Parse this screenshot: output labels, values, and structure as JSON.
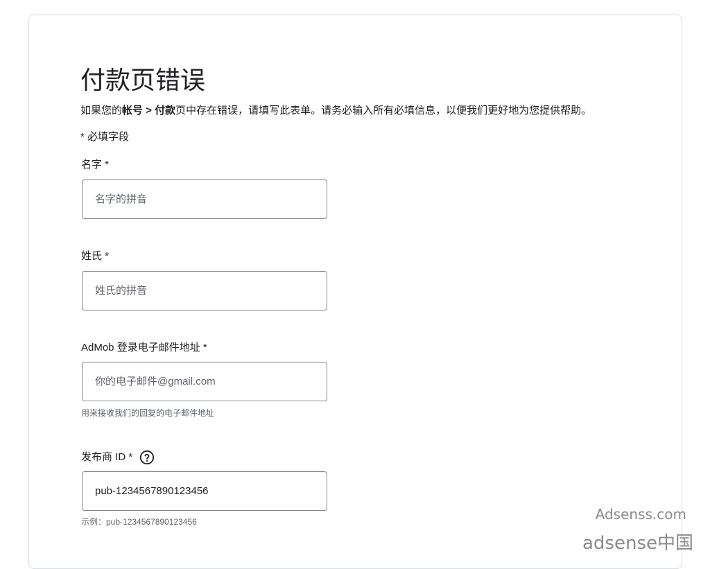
{
  "form": {
    "title": "付款页错误",
    "intro": {
      "prefix": "如果您的",
      "bold_account": "帐号 > 付款",
      "suffix": "页中存在错误，请填写此表单。请务必输入所有必填信息，以便我们更好地为您提供帮助。"
    },
    "required_note": "* 必填字段",
    "fields": {
      "first_name": {
        "label": "名字 *",
        "placeholder": "名字的拼音"
      },
      "last_name": {
        "label": "姓氏 *",
        "placeholder": "姓氏的拼音"
      },
      "email": {
        "label": "AdMob 登录电子邮件地址 *",
        "placeholder": "你的电子邮件@gmail.com",
        "hint": "用来接收我们的回复的电子邮件地址"
      },
      "publisher_id": {
        "label": "发布商 ID *",
        "value": "pub-1234567890123456",
        "hint": "示例：pub-1234567890123456",
        "help_icon": "help-circle-icon"
      }
    }
  },
  "watermark": {
    "line1": "Adsenss.com",
    "line2": "adsense中国"
  },
  "colors": {
    "border": "#dadce0",
    "input_border": "#80868b",
    "text": "#202124",
    "hint": "#5f6368"
  }
}
